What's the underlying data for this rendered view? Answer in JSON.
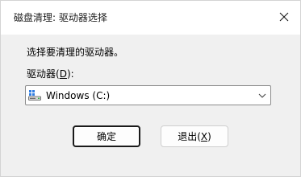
{
  "window": {
    "title": "磁盘清理: 驱动器选择"
  },
  "prompt": "选择要清理的驱动器。",
  "drive_label": {
    "text": "驱动器(",
    "accel": "D",
    "suffix": "):"
  },
  "drive_select": {
    "selected": "Windows (C:)",
    "icon": "drive-icon"
  },
  "buttons": {
    "ok_label": "确定",
    "exit_label": "退出(",
    "exit_accel": "X",
    "exit_suffix": ")"
  },
  "colors": {
    "dialog_bg": "#f0f0f0",
    "titlebar_bg": "#ffffff",
    "drive_icon_accent": "#2f7de1"
  }
}
